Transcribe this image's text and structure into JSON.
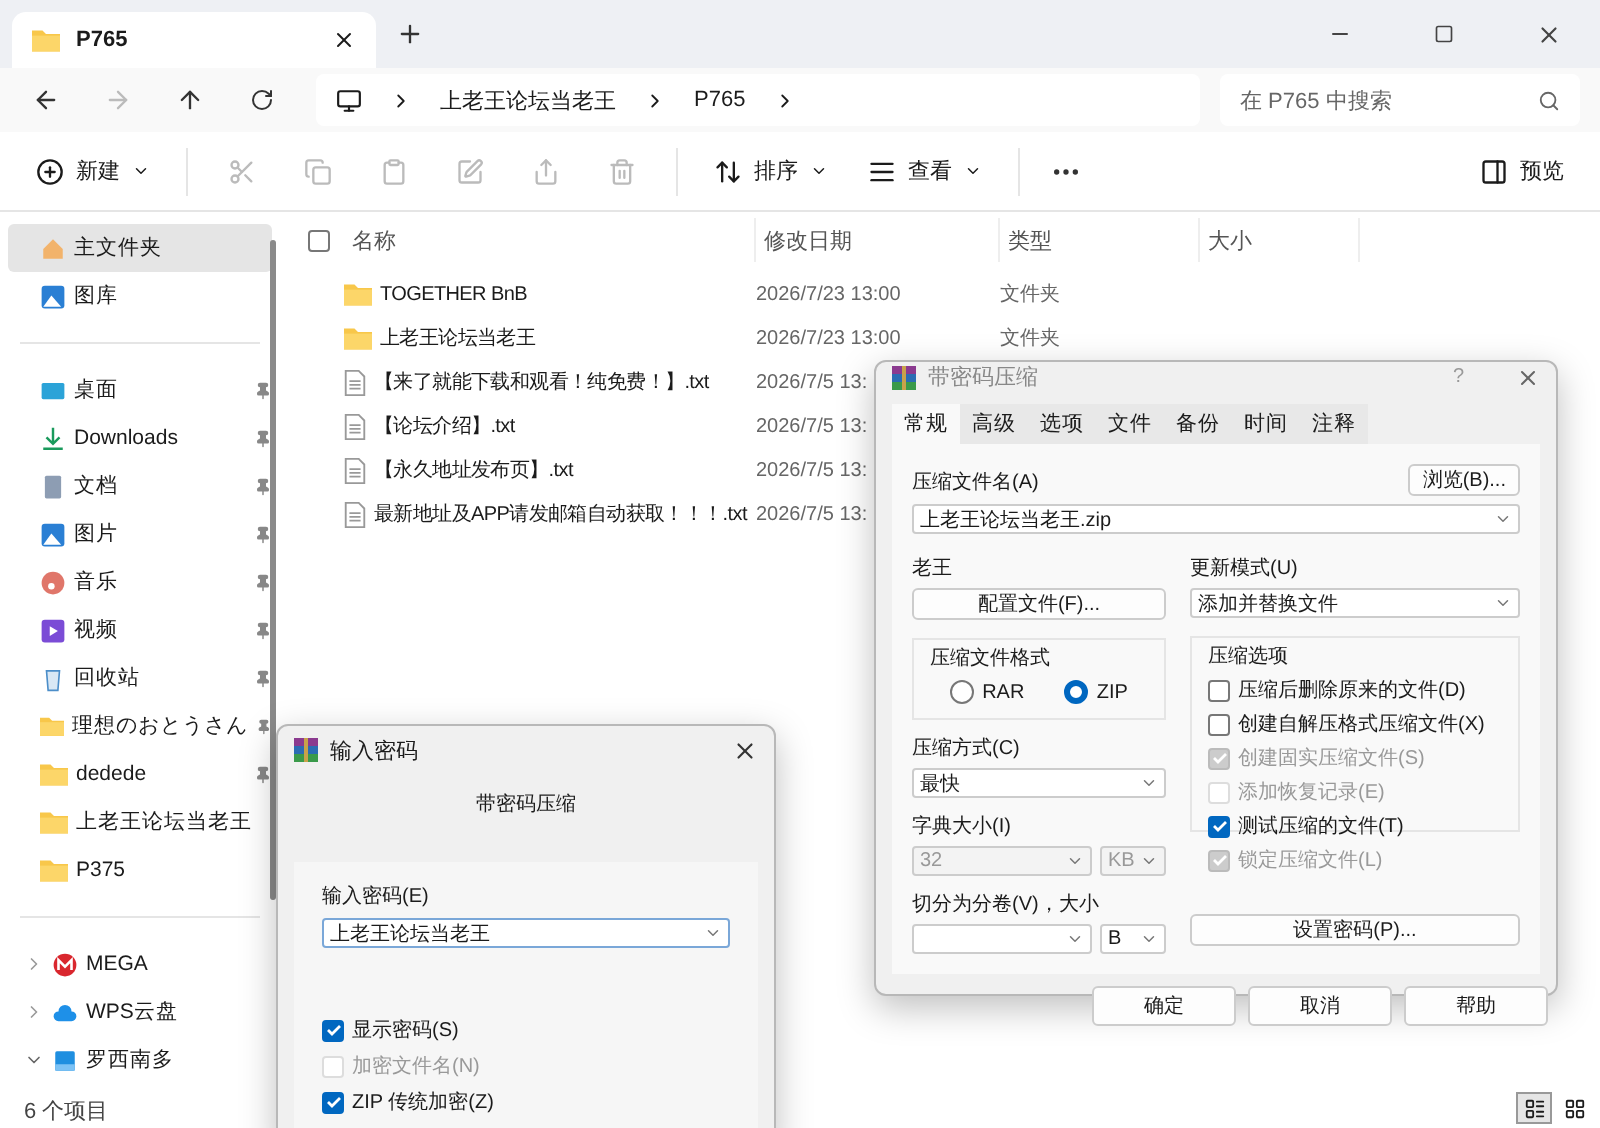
{
  "tabs": [
    {
      "title": "P765",
      "selected": true
    }
  ],
  "breadcrumb": [
    "上老王论坛当老王",
    "P765"
  ],
  "search": {
    "placeholder": "在 P765 中搜索"
  },
  "toolbar": {
    "new": "新建",
    "sort": "排序",
    "view": "查看",
    "preview": "预览"
  },
  "sidebar": {
    "top": [
      {
        "label": "主文件夹",
        "kind": "home",
        "selected": true
      },
      {
        "label": "图库",
        "kind": "gallery",
        "selected": false
      }
    ],
    "quick": [
      {
        "label": "桌面",
        "kind": "desktop",
        "pinned": true
      },
      {
        "label": "Downloads",
        "kind": "download",
        "pinned": true
      },
      {
        "label": "文档",
        "kind": "document",
        "pinned": true
      },
      {
        "label": "图片",
        "kind": "picture",
        "pinned": true
      },
      {
        "label": "音乐",
        "kind": "music",
        "pinned": true
      },
      {
        "label": "视频",
        "kind": "video",
        "pinned": true
      },
      {
        "label": "回收站",
        "kind": "recycle",
        "pinned": true
      },
      {
        "label": "理想のおとうさん",
        "kind": "folder",
        "pinned": true
      },
      {
        "label": "dedede",
        "kind": "folder",
        "pinned": true
      },
      {
        "label": "上老王论坛当老王",
        "kind": "folder",
        "pinned": false
      },
      {
        "label": "P375",
        "kind": "folder",
        "pinned": false
      }
    ],
    "drives": [
      {
        "label": "MEGA",
        "kind": "mega",
        "expanded": false
      },
      {
        "label": "WPS云盘",
        "kind": "cloud",
        "expanded": false
      },
      {
        "label": "罗西南多",
        "kind": "drive",
        "expanded": true
      }
    ]
  },
  "all_selected": false,
  "columns": [
    "名称",
    "修改日期",
    "类型",
    "大小"
  ],
  "files": [
    {
      "kind": "folder",
      "name": "TOGETHER BnB",
      "date": "2026/7/23 13:00",
      "type": "文件夹"
    },
    {
      "kind": "folder",
      "name": "上老王论坛当老王",
      "date": "2026/7/23 13:00",
      "type": "文件夹"
    },
    {
      "kind": "file",
      "name": "【来了就能下载和观看！纯免费！】.txt",
      "date": "2026/7/5 13:"
    },
    {
      "kind": "file",
      "name": "【论坛介绍】.txt",
      "date": "2026/7/5 13:"
    },
    {
      "kind": "file",
      "name": "【永久地址发布页】.txt",
      "date": "2026/7/5 13:"
    },
    {
      "kind": "file",
      "name": "最新地址及APP请发邮箱自动获取！！！.txt",
      "date": "2026/7/5 13:"
    }
  ],
  "status": "6 个项目",
  "archive_dialog": {
    "title": "带密码压缩",
    "help": "?",
    "tabs": [
      {
        "label": "常规",
        "selected": true
      },
      {
        "label": "高级",
        "selected": false
      },
      {
        "label": "选项",
        "selected": false
      },
      {
        "label": "文件",
        "selected": false
      },
      {
        "label": "备份",
        "selected": false
      },
      {
        "label": "时间",
        "selected": false
      },
      {
        "label": "注释",
        "selected": false
      }
    ],
    "name_label": "压缩文件名(A)",
    "browse": "浏览(B)...",
    "name_value": "上老王论坛当老王.zip",
    "profile_label": "老王",
    "profile_button": "配置文件(F)...",
    "update_label": "更新模式(U)",
    "update_value": "添加并替换文件",
    "format_label": "压缩文件格式",
    "formats": [
      {
        "label": "RAR",
        "selected": false
      },
      {
        "label": "ZIP",
        "selected": true
      }
    ],
    "method_label": "压缩方式(C)",
    "method_value": "最快",
    "dict_label": "字典大小(I)",
    "dict_value": "32",
    "dict_unit": "KB",
    "dict_disabled": true,
    "split_label": "切分为分卷(V)，大小",
    "split_unit": "B",
    "options_label": "压缩选项",
    "options": [
      {
        "label": "压缩后删除原来的文件(D)",
        "checked": false,
        "disabled": false
      },
      {
        "label": "创建自解压格式压缩文件(X)",
        "checked": false,
        "disabled": false
      },
      {
        "label": "创建固实压缩文件(S)",
        "checked": true,
        "disabled": true
      },
      {
        "label": "添加恢复记录(E)",
        "checked": false,
        "disabled": true
      },
      {
        "label": "测试压缩的文件(T)",
        "checked": true,
        "disabled": false
      },
      {
        "label": "锁定压缩文件(L)",
        "checked": true,
        "disabled": true
      }
    ],
    "password_button": "设置密码(P)...",
    "buttons": [
      "确定",
      "取消",
      "帮助"
    ]
  },
  "password_dialog": {
    "title": "输入密码",
    "subtitle": "带密码压缩",
    "label": "输入密码(E)",
    "value": "上老王论坛当老王",
    "options": [
      {
        "label": "显示密码(S)",
        "checked": true,
        "disabled": false
      },
      {
        "label": "加密文件名(N)",
        "checked": false,
        "disabled": true
      },
      {
        "label": "ZIP 传统加密(Z)",
        "checked": true,
        "disabled": false
      }
    ]
  }
}
